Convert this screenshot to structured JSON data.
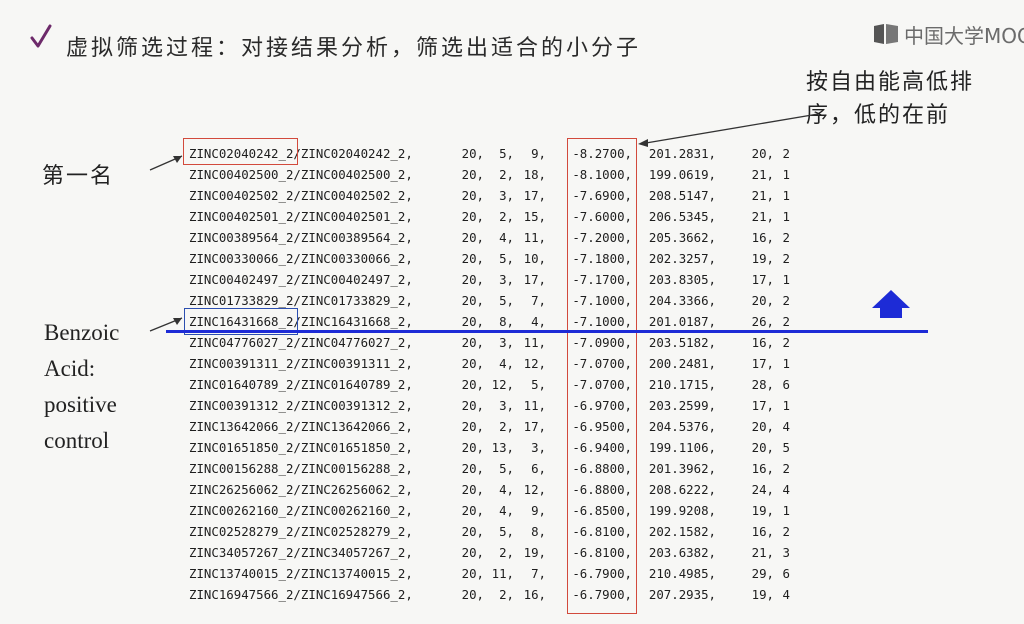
{
  "header": {
    "title": "虚拟筛选过程：对接结果分析，筛选出适合的小分子",
    "logo_text": "中国大学MOOC"
  },
  "annotations": {
    "sort_note": "按自由能高低排序，低的在前",
    "first_place": "第一名",
    "positive_control": "Benzoic Acid: positive control"
  },
  "colors": {
    "highlight_red": "#d24a3c",
    "highlight_blue": "#2c4fb0",
    "threshold_line": "#1d2bd6"
  },
  "rows": [
    {
      "id": "ZINC02040242_2/ZINC02040242_2,",
      "a": "20,",
      "b": "5,",
      "c": "9,",
      "score": "-8.2700,",
      "d": "201.2831,",
      "e": "20,",
      "f": "2"
    },
    {
      "id": "ZINC00402500_2/ZINC00402500_2,",
      "a": "20,",
      "b": "2,",
      "c": "18,",
      "score": "-8.1000,",
      "d": "199.0619,",
      "e": "21,",
      "f": "1"
    },
    {
      "id": "ZINC00402502_2/ZINC00402502_2,",
      "a": "20,",
      "b": "3,",
      "c": "17,",
      "score": "-7.6900,",
      "d": "208.5147,",
      "e": "21,",
      "f": "1"
    },
    {
      "id": "ZINC00402501_2/ZINC00402501_2,",
      "a": "20,",
      "b": "2,",
      "c": "15,",
      "score": "-7.6000,",
      "d": "206.5345,",
      "e": "21,",
      "f": "1"
    },
    {
      "id": "ZINC00389564_2/ZINC00389564_2,",
      "a": "20,",
      "b": "4,",
      "c": "11,",
      "score": "-7.2000,",
      "d": "205.3662,",
      "e": "16,",
      "f": "2"
    },
    {
      "id": "ZINC00330066_2/ZINC00330066_2,",
      "a": "20,",
      "b": "5,",
      "c": "10,",
      "score": "-7.1800,",
      "d": "202.3257,",
      "e": "19,",
      "f": "2"
    },
    {
      "id": "ZINC00402497_2/ZINC00402497_2,",
      "a": "20,",
      "b": "3,",
      "c": "17,",
      "score": "-7.1700,",
      "d": "203.8305,",
      "e": "17,",
      "f": "1"
    },
    {
      "id": "ZINC01733829_2/ZINC01733829_2,",
      "a": "20,",
      "b": "5,",
      "c": "7,",
      "score": "-7.1000,",
      "d": "204.3366,",
      "e": "20,",
      "f": "2"
    },
    {
      "id": "ZINC16431668_2/ZINC16431668_2,",
      "a": "20,",
      "b": "8,",
      "c": "4,",
      "score": "-7.1000,",
      "d": "201.0187,",
      "e": "26,",
      "f": "2"
    },
    {
      "id": "ZINC04776027_2/ZINC04776027_2,",
      "a": "20,",
      "b": "3,",
      "c": "11,",
      "score": "-7.0900,",
      "d": "203.5182,",
      "e": "16,",
      "f": "2"
    },
    {
      "id": "ZINC00391311_2/ZINC00391311_2,",
      "a": "20,",
      "b": "4,",
      "c": "12,",
      "score": "-7.0700,",
      "d": "200.2481,",
      "e": "17,",
      "f": "1"
    },
    {
      "id": "ZINC01640789_2/ZINC01640789_2,",
      "a": "20,",
      "b": "12,",
      "c": "5,",
      "score": "-7.0700,",
      "d": "210.1715,",
      "e": "28,",
      "f": "6"
    },
    {
      "id": "ZINC00391312_2/ZINC00391312_2,",
      "a": "20,",
      "b": "3,",
      "c": "11,",
      "score": "-6.9700,",
      "d": "203.2599,",
      "e": "17,",
      "f": "1"
    },
    {
      "id": "ZINC13642066_2/ZINC13642066_2,",
      "a": "20,",
      "b": "2,",
      "c": "17,",
      "score": "-6.9500,",
      "d": "204.5376,",
      "e": "20,",
      "f": "4"
    },
    {
      "id": "ZINC01651850_2/ZINC01651850_2,",
      "a": "20,",
      "b": "13,",
      "c": "3,",
      "score": "-6.9400,",
      "d": "199.1106,",
      "e": "20,",
      "f": "5"
    },
    {
      "id": "ZINC00156288_2/ZINC00156288_2,",
      "a": "20,",
      "b": "5,",
      "c": "6,",
      "score": "-6.8800,",
      "d": "201.3962,",
      "e": "16,",
      "f": "2"
    },
    {
      "id": "ZINC26256062_2/ZINC26256062_2,",
      "a": "20,",
      "b": "4,",
      "c": "12,",
      "score": "-6.8800,",
      "d": "208.6222,",
      "e": "24,",
      "f": "4"
    },
    {
      "id": "ZINC00262160_2/ZINC00262160_2,",
      "a": "20,",
      "b": "4,",
      "c": "9,",
      "score": "-6.8500,",
      "d": "199.9208,",
      "e": "19,",
      "f": "1"
    },
    {
      "id": "ZINC02528279_2/ZINC02528279_2,",
      "a": "20,",
      "b": "5,",
      "c": "8,",
      "score": "-6.8100,",
      "d": "202.1582,",
      "e": "16,",
      "f": "2"
    },
    {
      "id": "ZINC34057267_2/ZINC34057267_2,",
      "a": "20,",
      "b": "2,",
      "c": "19,",
      "score": "-6.8100,",
      "d": "203.6382,",
      "e": "21,",
      "f": "3"
    },
    {
      "id": "ZINC13740015_2/ZINC13740015_2,",
      "a": "20,",
      "b": "11,",
      "c": "7,",
      "score": "-6.7900,",
      "d": "210.4985,",
      "e": "29,",
      "f": "6"
    },
    {
      "id": "ZINC16947566_2/ZINC16947566_2,",
      "a": "20,",
      "b": "2,",
      "c": "16,",
      "score": "-6.7900,",
      "d": "207.2935,",
      "e": "19,",
      "f": "4"
    }
  ]
}
